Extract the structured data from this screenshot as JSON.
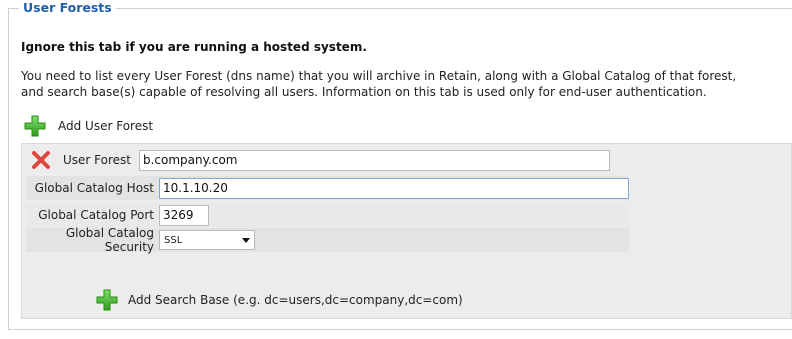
{
  "section": {
    "legend": "User Forests",
    "heading": "Ignore this tab if you are running a hosted system.",
    "description": "You need to list every User Forest (dns name) that you will archive in Retain, along with a Global Catalog of that forest, and search base(s) capable of resolving all users. Information on this tab is used only for end-user authentication."
  },
  "add_forest": {
    "label": "Add User Forest",
    "icon": "plus-icon"
  },
  "forest": {
    "user_forest_label": "User Forest",
    "user_forest_value": "b.company.com",
    "gc_host_label": "Global Catalog Host",
    "gc_host_value": "10.1.10.20",
    "gc_port_label": "Global Catalog Port",
    "gc_port_value": "3269",
    "gc_security_label": "Global Catalog Security",
    "gc_security_value": "SSL",
    "remove_icon": "close-icon"
  },
  "add_search_base": {
    "label": "Add Search Base (e.g. dc=users,dc=company,dc=com)",
    "icon": "plus-icon"
  },
  "colors": {
    "legend": "#1f5fa8",
    "plus": "#3fb52c",
    "remove": "#e0463b",
    "panel": "#ececec"
  }
}
